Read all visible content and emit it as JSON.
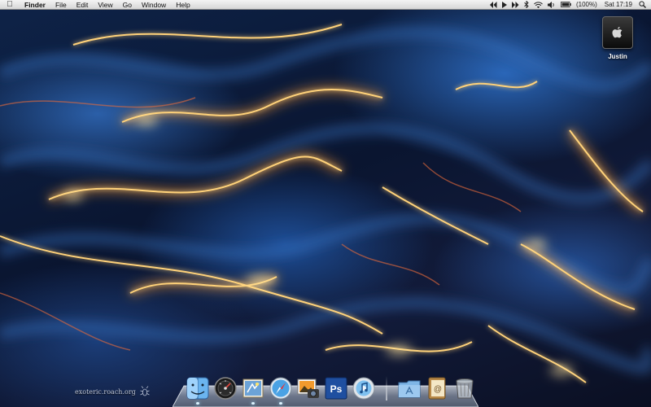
{
  "menubar": {
    "apple_icon": "apple-logo-icon",
    "app_name": "Finder",
    "menus": [
      "File",
      "Edit",
      "View",
      "Go",
      "Window",
      "Help"
    ],
    "status": {
      "battery_percent": "(100%)",
      "clock": "Sat 17:19"
    },
    "status_icons": [
      "rewind-icon",
      "play-icon",
      "fast-forward-icon",
      "bluetooth-icon",
      "wifi-icon",
      "volume-icon",
      "battery-icon",
      "spotlight-icon"
    ]
  },
  "desktop": {
    "drive": {
      "label": "Justin",
      "icon": "hard-drive-icon"
    },
    "signature": "exoteric.roach.org"
  },
  "dock": {
    "apps": [
      {
        "name": "Finder",
        "icon": "finder-icon",
        "running": true
      },
      {
        "name": "Dashboard",
        "icon": "dashboard-icon",
        "running": false
      },
      {
        "name": "Mail",
        "icon": "mail-icon",
        "running": true
      },
      {
        "name": "Safari",
        "icon": "safari-icon",
        "running": true
      },
      {
        "name": "iPhoto",
        "icon": "iphoto-icon",
        "running": false
      },
      {
        "name": "Photoshop",
        "icon": "photoshop-icon",
        "running": false,
        "glyph": "Ps"
      },
      {
        "name": "iTunes",
        "icon": "itunes-icon",
        "running": false
      }
    ],
    "others": [
      {
        "name": "Applications",
        "icon": "applications-folder-icon"
      },
      {
        "name": "Address Book",
        "icon": "address-book-icon"
      },
      {
        "name": "Trash",
        "icon": "trash-icon"
      }
    ]
  },
  "colors": {
    "menubar_top": "#f4f4f4",
    "menubar_bottom": "#d6d6d6",
    "wallpaper_blue": "#2a66b8",
    "wallpaper_orange": "#ffb04a"
  }
}
